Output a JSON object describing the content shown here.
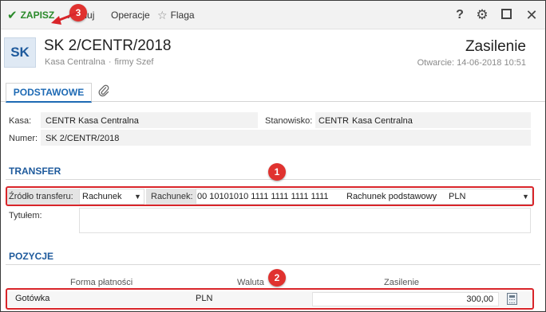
{
  "toolbar": {
    "save_label": "ZAPISZ",
    "cancel_label": "Anuluj",
    "operations_label": "Operacje",
    "flag_label": "Flaga",
    "help_glyph": "?",
    "icons": [
      "check-icon",
      "star-icon",
      "help-icon",
      "gear-icon",
      "maximize-icon",
      "close-icon"
    ]
  },
  "header": {
    "avatar_text": "SK",
    "title": "SK 2/CENTR/2018",
    "cashbox_name": "Kasa Centralna",
    "separator": "·",
    "company": "firmy Szef",
    "doc_type": "Zasilenie",
    "opened": "Otwarcie: 14-06-2018 10:51"
  },
  "tabs": {
    "main_label": "PODSTAWOWE",
    "attachment_icon": "paperclip-icon"
  },
  "general": {
    "kasa_label": "Kasa:",
    "kasa_code": "CENTR",
    "kasa_name": "Kasa Centralna",
    "station_label": "Stanowisko:",
    "station_code": "CENTR",
    "station_name": "Kasa Centralna",
    "number_label": "Numer:",
    "number_value": "SK 2/CENTR/2018"
  },
  "transfer": {
    "section_title": "TRANSFER",
    "source_label": "Źródło transferu:",
    "source_value": "Rachunek",
    "account_label": "Rachunek:",
    "account_number": "00 10101010 1111 1111 1111 1111",
    "account_name": "Rachunek podstawowy",
    "currency": "PLN",
    "title_label": "Tytułem:",
    "title_value": ""
  },
  "positions": {
    "section_title": "POZYCJE",
    "columns": [
      "Forma płatności",
      "Waluta",
      "Zasilenie"
    ],
    "rows": [
      {
        "payment_form": "Gotówka",
        "currency": "PLN",
        "amount": "300,00"
      }
    ]
  },
  "annotations": {
    "badges": [
      "1",
      "2",
      "3"
    ],
    "color": "#d9252a"
  },
  "colors": {
    "accent": "#1e6ab4",
    "save_green": "#2a8a2a",
    "annotation_red": "#d9252a"
  }
}
